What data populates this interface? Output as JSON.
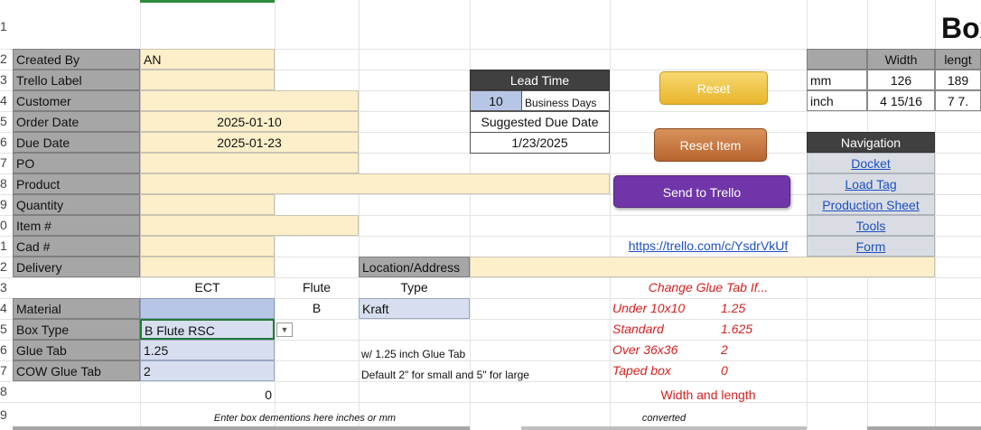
{
  "rows": [
    "1",
    "2",
    "3",
    "4",
    "5",
    "6",
    "7",
    "8",
    "9",
    "0",
    "1",
    "2",
    "3",
    "4",
    "5",
    "6",
    "7",
    "8",
    "9"
  ],
  "title": "Box",
  "labels": {
    "created_by": "Created By",
    "trello_label": "Trello Label",
    "customer": "Customer",
    "order_date": "Order Date",
    "due_date": "Due Date",
    "po": "PO",
    "product": "Product",
    "quantity": "Quantity",
    "item": "Item #",
    "cad": "Cad #",
    "delivery": "Delivery",
    "material": "Material",
    "box_type": "Box Type",
    "glue_tab": "Glue Tab",
    "cow_glue_tab": "COW Glue Tab",
    "location": "Location/Address"
  },
  "values": {
    "created_by": "AN",
    "order_date": "2025-01-10",
    "due_date": "2025-01-23",
    "material_flute": "B",
    "material_type": "Kraft",
    "box_type": "B Flute RSC",
    "glue_tab": "1.25",
    "cow_glue_tab": "2",
    "row18_value": "0"
  },
  "headers": {
    "ect": "ECT",
    "flute": "Flute",
    "type": "Type"
  },
  "notes": {
    "glue_tab_note": "w/ 1.25 inch Glue Tab",
    "cow_note": "Default 2\" for small and 5\" for large",
    "enter_dims": "Enter box dementions here inches or mm",
    "converted": "converted"
  },
  "lead_time": {
    "header": "Lead Time",
    "days": "10",
    "unit": "Business Days",
    "suggested_label": "Suggested Due Date",
    "suggested_value": "1/23/2025"
  },
  "buttons": {
    "reset": "Reset",
    "reset_item": "Reset Item",
    "send_trello": "Send to Trello"
  },
  "trello_link": "https://trello.com/c/YsdrVkUf",
  "glue_rules": {
    "title": "Change Glue Tab If...",
    "rows": [
      {
        "label": "Under 10x10",
        "value": "1.25"
      },
      {
        "label": "Standard",
        "value": "1.625"
      },
      {
        "label": "Over 36x36",
        "value": "2"
      },
      {
        "label": "Taped box",
        "value": "0"
      }
    ],
    "footer": "Width and length"
  },
  "dimensions": {
    "headers": [
      "Width",
      "lengt"
    ],
    "rows": [
      {
        "unit": "mm",
        "width": "126",
        "length": "189"
      },
      {
        "unit": "inch",
        "width": "4 15/16",
        "length": "7 7."
      }
    ]
  },
  "navigation": {
    "title": "Navigation",
    "links": [
      "Docket",
      "Load Tag",
      "Production Sheet",
      "Tools",
      "Form"
    ]
  },
  "colors": {
    "reset": "#f2c94c",
    "reset_item": "#c8763f",
    "send_trello": "#7035a8",
    "link": "#1d4fc4"
  }
}
